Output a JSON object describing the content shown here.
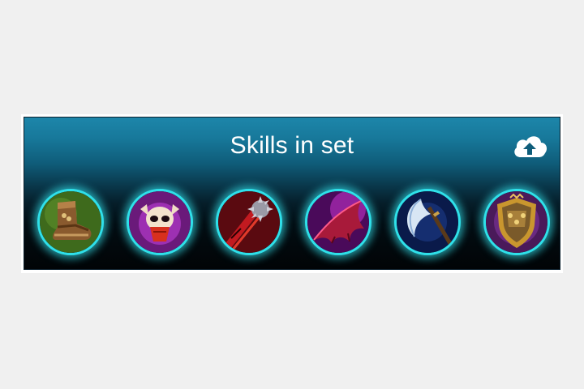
{
  "panel": {
    "title": "Skills in set",
    "upload_icon": "cloud-upload-icon"
  },
  "skills": [
    {
      "icon": "boots-icon"
    },
    {
      "icon": "horned-skull-icon"
    },
    {
      "icon": "spiked-mace-icon"
    },
    {
      "icon": "bat-wing-icon"
    },
    {
      "icon": "crescent-axe-icon"
    },
    {
      "icon": "golden-shield-icon"
    }
  ],
  "colors": {
    "header_top": "#1d86aa",
    "panel_bottom": "#010406",
    "slot_glow": "#2fe0ea"
  }
}
